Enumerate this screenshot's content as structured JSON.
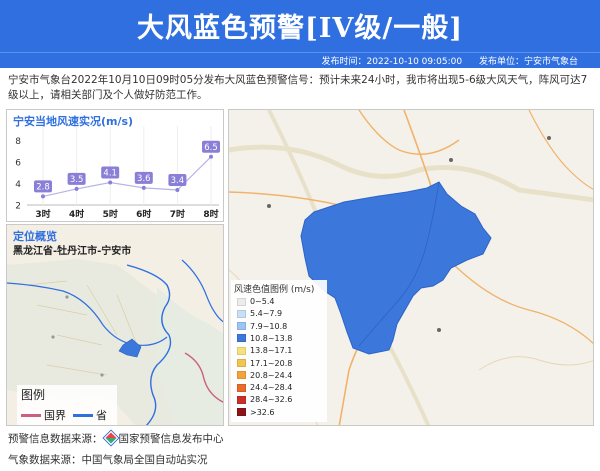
{
  "header": {
    "title": "大风蓝色预警[IV级/一般]"
  },
  "meta": {
    "time": "发布时间：2022-10-10 09:05:00",
    "unit": "发布单位：宁安市气象台"
  },
  "description": "宁安市气象台2022年10月10日09时05分发布大风蓝色预警信号：预计未来24小时，我市将出现5-6级大风天气，阵风可达7级以上，请相关部门及个人做好防范工作。",
  "wind_panel": {
    "title": "宁安当地风速实况(m/s)"
  },
  "chart_data": {
    "type": "line",
    "categories": [
      "3时",
      "4时",
      "5时",
      "6时",
      "7时",
      "8时"
    ],
    "values": [
      2.8,
      3.5,
      4.1,
      3.6,
      3.4,
      6.5
    ],
    "title": "宁安当地风速实况(m/s)",
    "ylim": [
      2,
      9
    ],
    "yticks": [
      "2",
      "4",
      "6",
      "8"
    ],
    "color": "#8a7fd6"
  },
  "location_panel": {
    "title": "定位概览",
    "path": "黑龙江省-牡丹江市-宁安市",
    "legend": {
      "title": "图例",
      "country": "国界",
      "province": "省界"
    },
    "country_color": "#c9617f",
    "province_color": "#2f6fe0"
  },
  "map_legend": {
    "title": "风速色值图例 (m/s)",
    "items": [
      {
        "label": "0~5.4",
        "color": "#ececec"
      },
      {
        "label": "5.4~7.9",
        "color": "#c9def7"
      },
      {
        "label": "7.9~10.8",
        "color": "#9cc4f4"
      },
      {
        "label": "10.8~13.8",
        "color": "#3c78dc"
      },
      {
        "label": "13.8~17.1",
        "color": "#f6e27a"
      },
      {
        "label": "17.1~20.8",
        "color": "#f4c451"
      },
      {
        "label": "20.8~24.4",
        "color": "#f3a33a"
      },
      {
        "label": "24.4~28.4",
        "color": "#ea6b2a"
      },
      {
        "label": "28.4~32.6",
        "color": "#c9302a"
      },
      {
        "label": ">32.6",
        "color": "#8c1419"
      }
    ],
    "region_color": "#3c78dc"
  },
  "sources": {
    "warning": "预警信息数据来源：",
    "warning_org": "国家预警信息发布中心",
    "weather": "气象数据来源：中国气象局全国自动站实况"
  }
}
